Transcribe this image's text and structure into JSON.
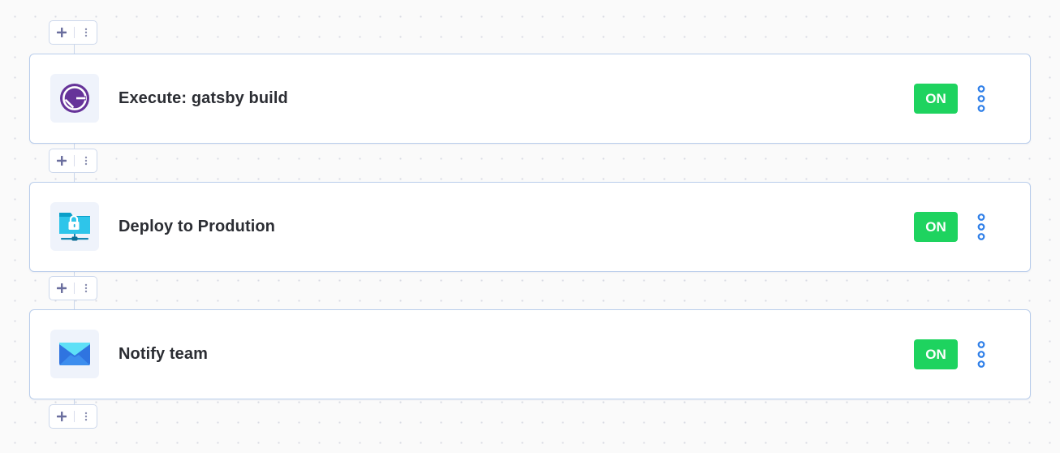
{
  "steps": [
    {
      "title": "Execute: gatsby build",
      "toggle": "ON",
      "icon": "gatsby-icon"
    },
    {
      "title": "Deploy to Prodution",
      "toggle": "ON",
      "icon": "secure-folder-icon"
    },
    {
      "title": "Notify team",
      "toggle": "ON",
      "icon": "envelope-icon"
    }
  ],
  "colors": {
    "toggle_on": "#1ed35f",
    "card_border": "#b9cdeb",
    "menu_dots": "#2f7fe8",
    "gatsby_purple": "#663399",
    "plus_icon": "#6a6e9e"
  }
}
